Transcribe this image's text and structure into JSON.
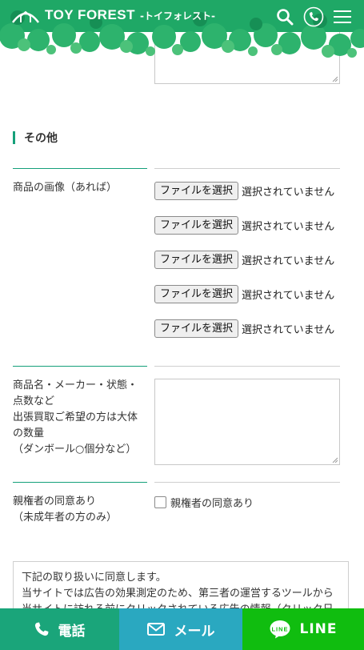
{
  "header": {
    "brand": "TOY FOREST",
    "subtitle": "-トイフォレスト-",
    "icons": [
      "search-icon",
      "phone-icon",
      "menu-icon"
    ]
  },
  "section": {
    "title": "その他"
  },
  "image_field": {
    "label": "商品の画像（あれば）",
    "button_label": "ファイルを選択",
    "status": "選択されていません",
    "count": 5
  },
  "details_field": {
    "label_lines": [
      "商品名・メーカー・状態・",
      "点数など",
      "出張買取ご希望の方は大体",
      "の数量",
      "（ダンボール○個分など）"
    ]
  },
  "guardian_field": {
    "label_lines": [
      "親権者の同意あり",
      "（未成年者の方のみ）"
    ],
    "checkbox_label": "親権者の同意あり"
  },
  "consent": {
    "lines": [
      "下記の取り扱いに同意します。",
      "当サイトでは広告の効果測定のため、第三者の運営するツールから",
      "当サイトに訪れる前にクリックされている広告の情報（クリック日"
    ]
  },
  "footer": {
    "tel_label": "電話",
    "mail_label": "メール",
    "line_label": "LINE"
  },
  "colors": {
    "brand_green": "#1aa57a",
    "mail_blue": "#2aa8c0",
    "line_green": "#10bd0f"
  }
}
